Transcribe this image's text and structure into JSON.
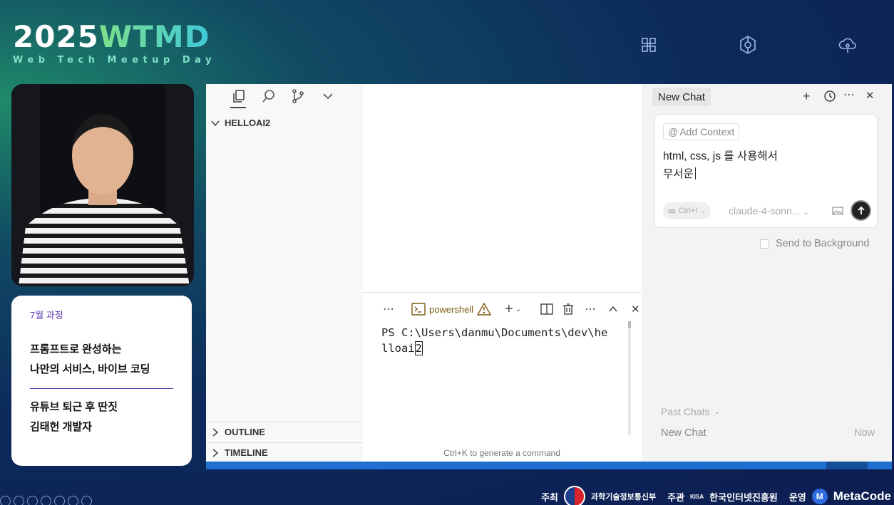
{
  "event": {
    "year": "2025",
    "name": "WTMD",
    "subtitle": "Web Tech Meetup Day"
  },
  "speaker_card": {
    "month": "7월 과정",
    "title_line1": "프롬프트로 완성하는",
    "title_line2": "나만의 서비스, 바이브 코딩",
    "author_line1": "유튜브 퇴근 후 딴짓",
    "author_line2": "김태헌 개발자"
  },
  "explorer": {
    "project": "HELLOAI2",
    "outline": "OUTLINE",
    "timeline": "TIMELINE"
  },
  "terminal": {
    "shell": "powershell",
    "prompt_text": "PS C:\\Users\\danmu\\Documents\\dev\\helloai",
    "cursor_char": "2",
    "hint": "Ctrl+K to generate a command"
  },
  "chat": {
    "tab_label": "New Chat",
    "context_button": "Add Context",
    "input_line1": "html, css, js 를 사용해서",
    "input_line2": "무서운",
    "mode_shortcut": "Ctrl+I",
    "model": "claude-4-sonn...",
    "send_to_background": "Send to Background",
    "past_chats_label": "Past Chats",
    "history": [
      {
        "title": "New Chat",
        "time": "Now"
      }
    ]
  },
  "sponsors": {
    "host_label": "주최",
    "host": "과학기술정보통신부",
    "organizer_label": "주관",
    "organizer_prefix": "KISA",
    "organizer": "한국인터넷진흥원",
    "operator_label": "운영",
    "operator": "MetaCode"
  },
  "colors": {
    "accent_green": "#7ee08a",
    "accent_cyan": "#3fc9d8",
    "card_accent": "#5a3bb0",
    "statusbar": "#1f6fd0"
  }
}
